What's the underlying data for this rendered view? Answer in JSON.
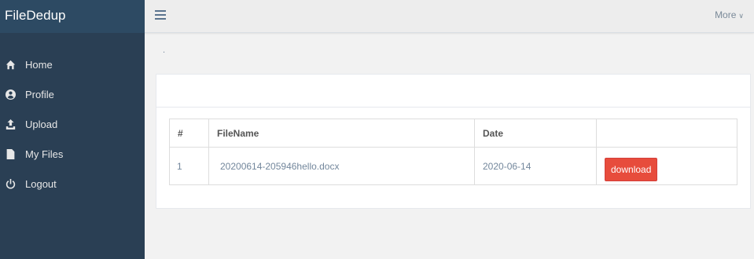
{
  "app": {
    "brand": "FileDedup"
  },
  "sidebar": {
    "items": [
      {
        "label": "Home",
        "icon": "home-icon"
      },
      {
        "label": "Profile",
        "icon": "user-icon"
      },
      {
        "label": "Upload",
        "icon": "upload-icon"
      },
      {
        "label": "My Files",
        "icon": "file-icon"
      },
      {
        "label": "Logout",
        "icon": "power-icon"
      }
    ]
  },
  "topbar": {
    "more_label": "More",
    "more_icon": "chevron-down-icon"
  },
  "main": {
    "page_title": ".",
    "table": {
      "headers": [
        "#",
        "FileName",
        "Date",
        ""
      ],
      "rows": [
        {
          "num": "1",
          "filename": "20200614-205946hello.docx",
          "date": "2020-06-14",
          "action_label": "download"
        }
      ]
    }
  },
  "colors": {
    "sidebar_bg": "#2a3f54",
    "brand_bg": "#2d4a63",
    "download_button": "#e74c3c"
  }
}
